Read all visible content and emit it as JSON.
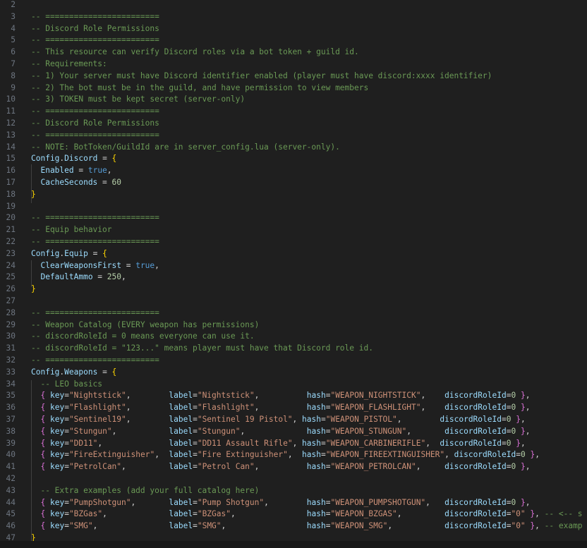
{
  "lines": [
    {
      "num": "2",
      "parts": []
    },
    {
      "num": "3",
      "parts": [
        {
          "t": "-- ========================",
          "c": "c"
        }
      ]
    },
    {
      "num": "4",
      "parts": [
        {
          "t": "-- Discord Role Permissions",
          "c": "c"
        }
      ]
    },
    {
      "num": "5",
      "parts": [
        {
          "t": "-- ========================",
          "c": "c"
        }
      ]
    },
    {
      "num": "6",
      "parts": [
        {
          "t": "-- This resource can verify Discord roles via a bot token + guild id.",
          "c": "c"
        }
      ]
    },
    {
      "num": "7",
      "parts": [
        {
          "t": "-- Requirements:",
          "c": "c"
        }
      ]
    },
    {
      "num": "8",
      "parts": [
        {
          "t": "-- 1) Your server must have Discord identifier enabled (player must have discord:xxxx identifier)",
          "c": "c"
        }
      ]
    },
    {
      "num": "9",
      "parts": [
        {
          "t": "-- 2) The bot must be in the guild, and have permission to view members",
          "c": "c"
        }
      ]
    },
    {
      "num": "10",
      "parts": [
        {
          "t": "-- 3) TOKEN must be kept secret (server-only)",
          "c": "c"
        }
      ]
    },
    {
      "num": "11",
      "parts": [
        {
          "t": "-- ========================",
          "c": "c"
        }
      ]
    },
    {
      "num": "12",
      "parts": [
        {
          "t": "-- Discord Role Permissions",
          "c": "c"
        }
      ]
    },
    {
      "num": "13",
      "parts": [
        {
          "t": "-- ========================",
          "c": "c"
        }
      ]
    },
    {
      "num": "14",
      "parts": [
        {
          "t": "-- NOTE: BotToken/GuildId are in server_config.lua (server-only).",
          "c": "c"
        }
      ]
    },
    {
      "num": "15",
      "parts": [
        {
          "t": "Config",
          "c": "cfg"
        },
        {
          "t": ".",
          "c": "p"
        },
        {
          "t": "Discord",
          "c": "k"
        },
        {
          "t": " = ",
          "c": "p"
        },
        {
          "t": "{",
          "c": "b1"
        }
      ]
    },
    {
      "num": "16",
      "parts": [
        {
          "t": "  Enabled",
          "c": "k"
        },
        {
          "t": " = ",
          "c": "p"
        },
        {
          "t": "true",
          "c": "v"
        },
        {
          "t": ",",
          "c": "p"
        }
      ]
    },
    {
      "num": "17",
      "parts": [
        {
          "t": "  CacheSeconds",
          "c": "k"
        },
        {
          "t": " = ",
          "c": "p"
        },
        {
          "t": "60",
          "c": "n"
        }
      ]
    },
    {
      "num": "18",
      "parts": [
        {
          "t": "}",
          "c": "b1"
        }
      ]
    },
    {
      "num": "19",
      "parts": []
    },
    {
      "num": "20",
      "parts": [
        {
          "t": "-- ========================",
          "c": "c"
        }
      ]
    },
    {
      "num": "21",
      "parts": [
        {
          "t": "-- Equip behavior",
          "c": "c"
        }
      ]
    },
    {
      "num": "22",
      "parts": [
        {
          "t": "-- ========================",
          "c": "c"
        }
      ]
    },
    {
      "num": "23",
      "parts": [
        {
          "t": "Config",
          "c": "cfg"
        },
        {
          "t": ".",
          "c": "p"
        },
        {
          "t": "Equip",
          "c": "k"
        },
        {
          "t": " = ",
          "c": "p"
        },
        {
          "t": "{",
          "c": "b1"
        }
      ]
    },
    {
      "num": "24",
      "parts": [
        {
          "t": "  ClearWeaponsFirst",
          "c": "k"
        },
        {
          "t": " = ",
          "c": "p"
        },
        {
          "t": "true",
          "c": "v"
        },
        {
          "t": ",",
          "c": "p"
        }
      ]
    },
    {
      "num": "25",
      "parts": [
        {
          "t": "  DefaultAmmo",
          "c": "k"
        },
        {
          "t": " = ",
          "c": "p"
        },
        {
          "t": "250",
          "c": "n"
        },
        {
          "t": ",",
          "c": "p"
        }
      ]
    },
    {
      "num": "26",
      "parts": [
        {
          "t": "}",
          "c": "b1"
        }
      ]
    },
    {
      "num": "27",
      "parts": []
    },
    {
      "num": "28",
      "parts": [
        {
          "t": "-- ========================",
          "c": "c"
        }
      ]
    },
    {
      "num": "29",
      "parts": [
        {
          "t": "-- Weapon Catalog (EVERY weapon has permissions)",
          "c": "c"
        }
      ]
    },
    {
      "num": "30",
      "parts": [
        {
          "t": "-- discordRoleId = 0 means everyone can use it.",
          "c": "c"
        }
      ]
    },
    {
      "num": "31",
      "parts": [
        {
          "t": "-- discordRoleId = \"123...\" means player must have that Discord role id.",
          "c": "c"
        }
      ]
    },
    {
      "num": "32",
      "parts": [
        {
          "t": "-- ========================",
          "c": "c"
        }
      ]
    },
    {
      "num": "33",
      "parts": [
        {
          "t": "Config",
          "c": "cfg"
        },
        {
          "t": ".",
          "c": "p"
        },
        {
          "t": "Weapons",
          "c": "k"
        },
        {
          "t": " = ",
          "c": "p"
        },
        {
          "t": "{",
          "c": "b1"
        }
      ]
    },
    {
      "num": "34",
      "parts": [
        {
          "t": "  -- LEO basics",
          "c": "c"
        }
      ]
    },
    {
      "num": "35",
      "parts": [
        {
          "t": "  ",
          "c": "p"
        },
        {
          "t": "{",
          "c": "b2"
        },
        {
          "t": " key",
          "c": "k"
        },
        {
          "t": "=",
          "c": "p"
        },
        {
          "t": "\"Nightstick\"",
          "c": "s"
        },
        {
          "t": ",        ",
          "c": "p"
        },
        {
          "t": "label",
          "c": "k"
        },
        {
          "t": "=",
          "c": "p"
        },
        {
          "t": "\"Nightstick\"",
          "c": "s"
        },
        {
          "t": ",          ",
          "c": "p"
        },
        {
          "t": "hash",
          "c": "k"
        },
        {
          "t": "=",
          "c": "p"
        },
        {
          "t": "\"WEAPON_NIGHTSTICK\"",
          "c": "s"
        },
        {
          "t": ",    ",
          "c": "p"
        },
        {
          "t": "discordRoleId",
          "c": "k"
        },
        {
          "t": "=",
          "c": "p"
        },
        {
          "t": "0",
          "c": "n"
        },
        {
          "t": " ",
          "c": "p"
        },
        {
          "t": "}",
          "c": "b2"
        },
        {
          "t": ",",
          "c": "p"
        }
      ]
    },
    {
      "num": "36",
      "parts": [
        {
          "t": "  ",
          "c": "p"
        },
        {
          "t": "{",
          "c": "b2"
        },
        {
          "t": " key",
          "c": "k"
        },
        {
          "t": "=",
          "c": "p"
        },
        {
          "t": "\"Flashlight\"",
          "c": "s"
        },
        {
          "t": ",        ",
          "c": "p"
        },
        {
          "t": "label",
          "c": "k"
        },
        {
          "t": "=",
          "c": "p"
        },
        {
          "t": "\"Flashlight\"",
          "c": "s"
        },
        {
          "t": ",          ",
          "c": "p"
        },
        {
          "t": "hash",
          "c": "k"
        },
        {
          "t": "=",
          "c": "p"
        },
        {
          "t": "\"WEAPON_FLASHLIGHT\"",
          "c": "s"
        },
        {
          "t": ",    ",
          "c": "p"
        },
        {
          "t": "discordRoleId",
          "c": "k"
        },
        {
          "t": "=",
          "c": "p"
        },
        {
          "t": "0",
          "c": "n"
        },
        {
          "t": " ",
          "c": "p"
        },
        {
          "t": "}",
          "c": "b2"
        },
        {
          "t": ",",
          "c": "p"
        }
      ]
    },
    {
      "num": "37",
      "parts": [
        {
          "t": "  ",
          "c": "p"
        },
        {
          "t": "{",
          "c": "b2"
        },
        {
          "t": " key",
          "c": "k"
        },
        {
          "t": "=",
          "c": "p"
        },
        {
          "t": "\"Sentinel19\"",
          "c": "s"
        },
        {
          "t": ",        ",
          "c": "p"
        },
        {
          "t": "label",
          "c": "k"
        },
        {
          "t": "=",
          "c": "p"
        },
        {
          "t": "\"Sentinel 19 Pistol\"",
          "c": "s"
        },
        {
          "t": ", ",
          "c": "p"
        },
        {
          "t": "hash",
          "c": "k"
        },
        {
          "t": "=",
          "c": "p"
        },
        {
          "t": "\"WEAPON_PISTOL\"",
          "c": "s"
        },
        {
          "t": ",        ",
          "c": "p"
        },
        {
          "t": "discordRoleId",
          "c": "k"
        },
        {
          "t": "=",
          "c": "p"
        },
        {
          "t": "0",
          "c": "n"
        },
        {
          "t": " ",
          "c": "p"
        },
        {
          "t": "}",
          "c": "b2"
        },
        {
          "t": ",",
          "c": "p"
        }
      ]
    },
    {
      "num": "38",
      "parts": [
        {
          "t": "  ",
          "c": "p"
        },
        {
          "t": "{",
          "c": "b2"
        },
        {
          "t": " key",
          "c": "k"
        },
        {
          "t": "=",
          "c": "p"
        },
        {
          "t": "\"Stungun\"",
          "c": "s"
        },
        {
          "t": ",           ",
          "c": "p"
        },
        {
          "t": "label",
          "c": "k"
        },
        {
          "t": "=",
          "c": "p"
        },
        {
          "t": "\"Stungun\"",
          "c": "s"
        },
        {
          "t": ",             ",
          "c": "p"
        },
        {
          "t": "hash",
          "c": "k"
        },
        {
          "t": "=",
          "c": "p"
        },
        {
          "t": "\"WEAPON_STUNGUN\"",
          "c": "s"
        },
        {
          "t": ",       ",
          "c": "p"
        },
        {
          "t": "discordRoleId",
          "c": "k"
        },
        {
          "t": "=",
          "c": "p"
        },
        {
          "t": "0",
          "c": "n"
        },
        {
          "t": " ",
          "c": "p"
        },
        {
          "t": "}",
          "c": "b2"
        },
        {
          "t": ",",
          "c": "p"
        }
      ]
    },
    {
      "num": "39",
      "parts": [
        {
          "t": "  ",
          "c": "p"
        },
        {
          "t": "{",
          "c": "b2"
        },
        {
          "t": " key",
          "c": "k"
        },
        {
          "t": "=",
          "c": "p"
        },
        {
          "t": "\"DD11\"",
          "c": "s"
        },
        {
          "t": ",              ",
          "c": "p"
        },
        {
          "t": "label",
          "c": "k"
        },
        {
          "t": "=",
          "c": "p"
        },
        {
          "t": "\"DD11 Assault Rifle\"",
          "c": "s"
        },
        {
          "t": ", ",
          "c": "p"
        },
        {
          "t": "hash",
          "c": "k"
        },
        {
          "t": "=",
          "c": "p"
        },
        {
          "t": "\"WEAPON_CARBINERIFLE\"",
          "c": "s"
        },
        {
          "t": ",  ",
          "c": "p"
        },
        {
          "t": "discordRoleId",
          "c": "k"
        },
        {
          "t": "=",
          "c": "p"
        },
        {
          "t": "0",
          "c": "n"
        },
        {
          "t": " ",
          "c": "p"
        },
        {
          "t": "}",
          "c": "b2"
        },
        {
          "t": ",",
          "c": "p"
        }
      ]
    },
    {
      "num": "40",
      "parts": [
        {
          "t": "  ",
          "c": "p"
        },
        {
          "t": "{",
          "c": "b2"
        },
        {
          "t": " key",
          "c": "k"
        },
        {
          "t": "=",
          "c": "p"
        },
        {
          "t": "\"FireExtinguisher\"",
          "c": "s"
        },
        {
          "t": ",  ",
          "c": "p"
        },
        {
          "t": "label",
          "c": "k"
        },
        {
          "t": "=",
          "c": "p"
        },
        {
          "t": "\"Fire Extinguisher\"",
          "c": "s"
        },
        {
          "t": ",  ",
          "c": "p"
        },
        {
          "t": "hash",
          "c": "k"
        },
        {
          "t": "=",
          "c": "p"
        },
        {
          "t": "\"WEAPON_FIREEXTINGUISHER\"",
          "c": "s"
        },
        {
          "t": ", ",
          "c": "p"
        },
        {
          "t": "discordRoleId",
          "c": "k"
        },
        {
          "t": "=",
          "c": "p"
        },
        {
          "t": "0",
          "c": "n"
        },
        {
          "t": " ",
          "c": "p"
        },
        {
          "t": "}",
          "c": "b2"
        },
        {
          "t": ",",
          "c": "p"
        }
      ]
    },
    {
      "num": "41",
      "parts": [
        {
          "t": "  ",
          "c": "p"
        },
        {
          "t": "{",
          "c": "b2"
        },
        {
          "t": " key",
          "c": "k"
        },
        {
          "t": "=",
          "c": "p"
        },
        {
          "t": "\"PetrolCan\"",
          "c": "s"
        },
        {
          "t": ",         ",
          "c": "p"
        },
        {
          "t": "label",
          "c": "k"
        },
        {
          "t": "=",
          "c": "p"
        },
        {
          "t": "\"Petrol Can\"",
          "c": "s"
        },
        {
          "t": ",          ",
          "c": "p"
        },
        {
          "t": "hash",
          "c": "k"
        },
        {
          "t": "=",
          "c": "p"
        },
        {
          "t": "\"WEAPON_PETROLCAN\"",
          "c": "s"
        },
        {
          "t": ",     ",
          "c": "p"
        },
        {
          "t": "discordRoleId",
          "c": "k"
        },
        {
          "t": "=",
          "c": "p"
        },
        {
          "t": "0",
          "c": "n"
        },
        {
          "t": " ",
          "c": "p"
        },
        {
          "t": "}",
          "c": "b2"
        },
        {
          "t": ",",
          "c": "p"
        }
      ]
    },
    {
      "num": "42",
      "parts": []
    },
    {
      "num": "43",
      "parts": [
        {
          "t": "  -- Extra examples (add your full catalog here)",
          "c": "c"
        }
      ]
    },
    {
      "num": "44",
      "parts": [
        {
          "t": "  ",
          "c": "p"
        },
        {
          "t": "{",
          "c": "b2"
        },
        {
          "t": " key",
          "c": "k"
        },
        {
          "t": "=",
          "c": "p"
        },
        {
          "t": "\"PumpShotgun\"",
          "c": "s"
        },
        {
          "t": ",       ",
          "c": "p"
        },
        {
          "t": "label",
          "c": "k"
        },
        {
          "t": "=",
          "c": "p"
        },
        {
          "t": "\"Pump Shotgun\"",
          "c": "s"
        },
        {
          "t": ",        ",
          "c": "p"
        },
        {
          "t": "hash",
          "c": "k"
        },
        {
          "t": "=",
          "c": "p"
        },
        {
          "t": "\"WEAPON_PUMPSHOTGUN\"",
          "c": "s"
        },
        {
          "t": ",   ",
          "c": "p"
        },
        {
          "t": "discordRoleId",
          "c": "k"
        },
        {
          "t": "=",
          "c": "p"
        },
        {
          "t": "0",
          "c": "n"
        },
        {
          "t": " ",
          "c": "p"
        },
        {
          "t": "}",
          "c": "b2"
        },
        {
          "t": ",",
          "c": "p"
        }
      ]
    },
    {
      "num": "45",
      "parts": [
        {
          "t": "  ",
          "c": "p"
        },
        {
          "t": "{",
          "c": "b2"
        },
        {
          "t": " key",
          "c": "k"
        },
        {
          "t": "=",
          "c": "p"
        },
        {
          "t": "\"BZGas\"",
          "c": "s"
        },
        {
          "t": ",             ",
          "c": "p"
        },
        {
          "t": "label",
          "c": "k"
        },
        {
          "t": "=",
          "c": "p"
        },
        {
          "t": "\"BZGas\"",
          "c": "s"
        },
        {
          "t": ",               ",
          "c": "p"
        },
        {
          "t": "hash",
          "c": "k"
        },
        {
          "t": "=",
          "c": "p"
        },
        {
          "t": "\"WEAPON_BZGAS\"",
          "c": "s"
        },
        {
          "t": ",         ",
          "c": "p"
        },
        {
          "t": "discordRoleId",
          "c": "k"
        },
        {
          "t": "=",
          "c": "p"
        },
        {
          "t": "\"0\"",
          "c": "s"
        },
        {
          "t": " ",
          "c": "p"
        },
        {
          "t": "}",
          "c": "b2"
        },
        {
          "t": ", ",
          "c": "p"
        },
        {
          "t": "-- <-- s",
          "c": "c"
        }
      ]
    },
    {
      "num": "46",
      "parts": [
        {
          "t": "  ",
          "c": "p"
        },
        {
          "t": "{",
          "c": "b2"
        },
        {
          "t": " key",
          "c": "k"
        },
        {
          "t": "=",
          "c": "p"
        },
        {
          "t": "\"SMG\"",
          "c": "s"
        },
        {
          "t": ",               ",
          "c": "p"
        },
        {
          "t": "label",
          "c": "k"
        },
        {
          "t": "=",
          "c": "p"
        },
        {
          "t": "\"SMG\"",
          "c": "s"
        },
        {
          "t": ",                 ",
          "c": "p"
        },
        {
          "t": "hash",
          "c": "k"
        },
        {
          "t": "=",
          "c": "p"
        },
        {
          "t": "\"WEAPON_SMG\"",
          "c": "s"
        },
        {
          "t": ",           ",
          "c": "p"
        },
        {
          "t": "discordRoleId",
          "c": "k"
        },
        {
          "t": "=",
          "c": "p"
        },
        {
          "t": "\"0\"",
          "c": "s"
        },
        {
          "t": " ",
          "c": "p"
        },
        {
          "t": "}",
          "c": "b2"
        },
        {
          "t": ", ",
          "c": "p"
        },
        {
          "t": "-- examp",
          "c": "c"
        }
      ]
    },
    {
      "num": "47",
      "parts": [
        {
          "t": "}",
          "c": "b1"
        }
      ]
    }
  ]
}
